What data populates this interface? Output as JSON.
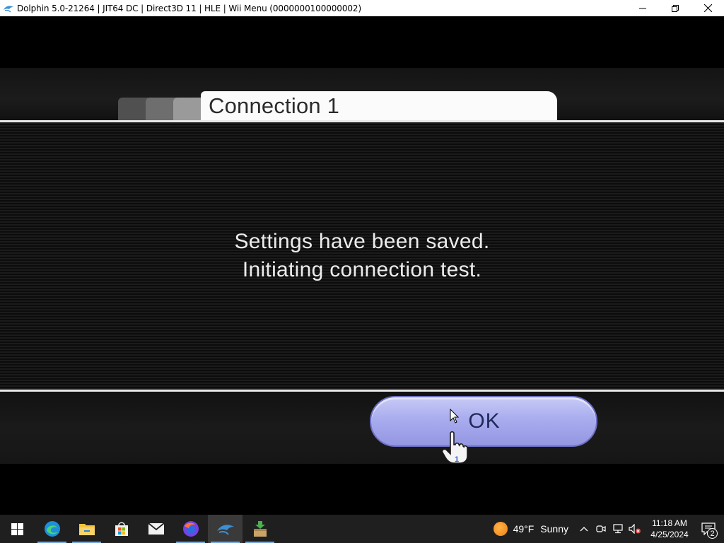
{
  "window": {
    "title": "Dolphin 5.0-21264 | JIT64 DC | Direct3D 11 | HLE | Wii Menu (0000000100000002)",
    "app_icon": "dolphin-icon",
    "controls": [
      "minimize-icon",
      "restore-icon",
      "close-icon"
    ]
  },
  "game": {
    "tab_label": "Connection 1",
    "message_line1": "Settings have been saved.",
    "message_line2": "Initiating connection test.",
    "ok_label": "OK",
    "ok_color": "#a9acee",
    "cursor_player": "1"
  },
  "taskbar": {
    "items": [
      {
        "icon": "windows-start-icon",
        "active": false
      },
      {
        "icon": "edge-icon",
        "active": false
      },
      {
        "icon": "file-explorer-icon",
        "active": false
      },
      {
        "icon": "microsoft-store-icon",
        "active": false
      },
      {
        "icon": "mail-icon",
        "active": false
      },
      {
        "icon": "firefox-icon",
        "active": false
      },
      {
        "icon": "dolphin-icon",
        "active": true
      },
      {
        "icon": "installer-icon",
        "active": false
      }
    ],
    "weather_temp": "49°F",
    "weather_condition": "Sunny",
    "time": "11:18 AM",
    "date": "4/25/2024",
    "notification_count": "2"
  }
}
